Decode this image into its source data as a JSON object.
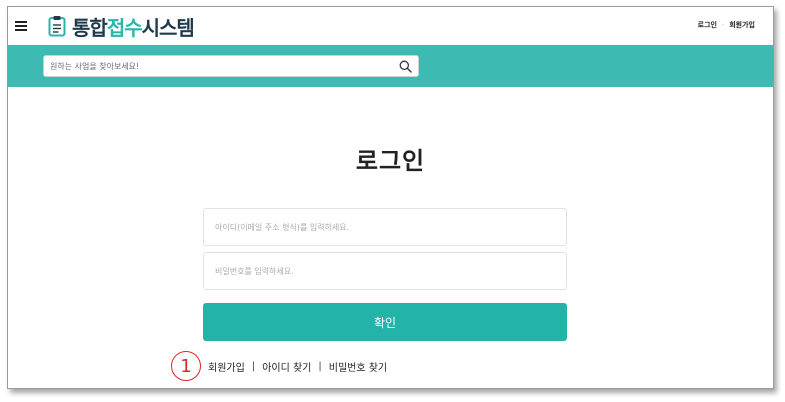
{
  "header": {
    "logo": {
      "part1": "통합",
      "part2": "접수",
      "part3": "시스템"
    },
    "login_link": "로그인",
    "separator": "·",
    "signup_link": "회원가입"
  },
  "search": {
    "placeholder": "원하는 사업을 찾아보세요!",
    "value": ""
  },
  "login": {
    "title": "로그인",
    "id_placeholder": "아이디(이메일 주소 형식)를 입력하세요.",
    "password_placeholder": "비밀번호를 입력하세요.",
    "confirm_label": "확인",
    "step_marker": "1",
    "links": {
      "signup": "회원가입",
      "find_id": "아이디 찾기",
      "find_password": "비밀번호 찾기",
      "divider": "|"
    }
  },
  "colors": {
    "brand_teal": "#3dbab1",
    "button_teal": "#24b3a8",
    "logo_dark": "#1f3a4d",
    "marker_red": "#e0242b"
  },
  "icons": {
    "menu": "hamburger-icon",
    "logo": "clipboard-icon",
    "search": "search-icon"
  }
}
